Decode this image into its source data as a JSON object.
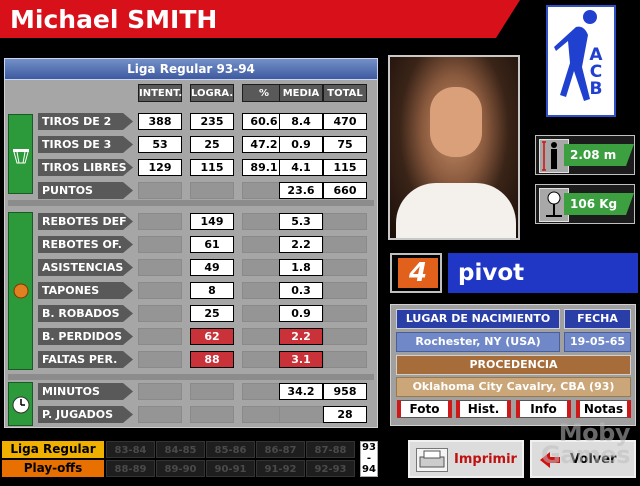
{
  "player": {
    "name": "Michael SMITH",
    "number": "4",
    "position": "pivot",
    "height": "2.08 m",
    "weight": "106 Kg"
  },
  "stats_title": "Liga Regular 93-94",
  "columns": [
    "INTENT.",
    "LOGRA.",
    "%",
    "MEDIA",
    "TOTAL"
  ],
  "shooting_rows": [
    {
      "label": "TIROS DE 2",
      "intent": "388",
      "logra": "235",
      "pct": "60.6",
      "media": "8.4",
      "total": "470"
    },
    {
      "label": "TIROS DE 3",
      "intent": "53",
      "logra": "25",
      "pct": "47.2",
      "media": "0.9",
      "total": "75"
    },
    {
      "label": "TIROS LIBRES",
      "intent": "129",
      "logra": "115",
      "pct": "89.1",
      "media": "4.1",
      "total": "115"
    },
    {
      "label": "PUNTOS",
      "media": "23.6",
      "total": "660"
    }
  ],
  "other_rows": [
    {
      "label": "REBOTES DEF",
      "logra": "149",
      "media": "5.3",
      "bad": false
    },
    {
      "label": "REBOTES OF.",
      "logra": "61",
      "media": "2.2",
      "bad": false
    },
    {
      "label": "ASISTENCIAS",
      "logra": "49",
      "media": "1.8",
      "bad": false
    },
    {
      "label": "TAPONES",
      "logra": "8",
      "media": "0.3",
      "bad": false
    },
    {
      "label": "B. ROBADOS",
      "logra": "25",
      "media": "0.9",
      "bad": false
    },
    {
      "label": "B. PERDIDOS",
      "logra": "62",
      "media": "2.2",
      "bad": true
    },
    {
      "label": "FALTAS PER.",
      "logra": "88",
      "media": "3.1",
      "bad": true
    }
  ],
  "time_rows": [
    {
      "label": "MINUTOS",
      "media": "34.2",
      "total": "958"
    },
    {
      "label": "P. JUGADOS",
      "total": "28"
    }
  ],
  "logo": {
    "text": "ACB"
  },
  "info": {
    "birthplace_label": "LUGAR DE NACIMIENTO",
    "birthplace": "Rochester, NY (USA)",
    "date_label": "FECHA",
    "date": "19-05-65",
    "origin_label": "PROCEDENCIA",
    "origin": "Oklahoma City Cavalry, CBA (93)"
  },
  "tabs": [
    "Foto",
    "Hist.",
    "Info",
    "Notas"
  ],
  "bottom": {
    "regular_label": "Liga Regular",
    "playoffs_label": "Play-offs",
    "seasons_top": [
      "83-84",
      "84-85",
      "85-86",
      "86-87",
      "87-88"
    ],
    "seasons_bottom": [
      "88-89",
      "89-90",
      "90-91",
      "91-92",
      "92-93"
    ],
    "year_top": "93",
    "year_sep": "-",
    "year_bottom": "94",
    "print_label": "Imprimir",
    "back_label": "Volver"
  },
  "watermark": "Moby Games",
  "colors": {
    "title_red": "#d8101a",
    "pivot_blue": "#2036c4",
    "number_orange": "#e0601c",
    "green": "#2c9a3a"
  }
}
